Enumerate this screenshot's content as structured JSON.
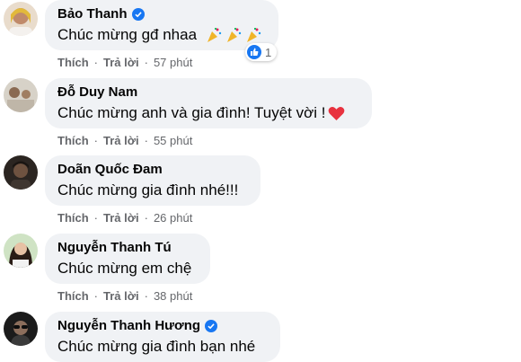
{
  "comments": [
    {
      "name": "Bảo Thanh",
      "verified": true,
      "text": "Chúc mừng gđ nhaa",
      "emoji": "party-popper x3",
      "actions": {
        "like": "Thích",
        "reply": "Trả lời",
        "time": "57 phút"
      },
      "reaction": {
        "icon": "like-icon",
        "count": "1"
      }
    },
    {
      "name": "Đỗ Duy Nam",
      "verified": false,
      "text": "Chúc mừng anh và gia đình! Tuyệt vời !",
      "emoji": "red-heart",
      "actions": {
        "like": "Thích",
        "reply": "Trả lời",
        "time": "55 phút"
      }
    },
    {
      "name": "Doãn Quốc Đam",
      "verified": false,
      "text": "Chúc mừng gia đình nhé!!!",
      "actions": {
        "like": "Thích",
        "reply": "Trả lời",
        "time": "26 phút"
      }
    },
    {
      "name": "Nguyễn Thanh Tú",
      "verified": false,
      "text": "Chúc mừng em chệ",
      "actions": {
        "like": "Thích",
        "reply": "Trả lời",
        "time": "38 phút"
      }
    },
    {
      "name": "Nguyễn Thanh Hương",
      "verified": true,
      "text": "Chúc mừng gia đình bạn nhé"
    }
  ],
  "colors": {
    "bubble": "#f0f2f5",
    "verified": "#1877f2",
    "meta_text": "#65676b",
    "like_blue": "#1877f2",
    "heart": "#e8323f"
  }
}
